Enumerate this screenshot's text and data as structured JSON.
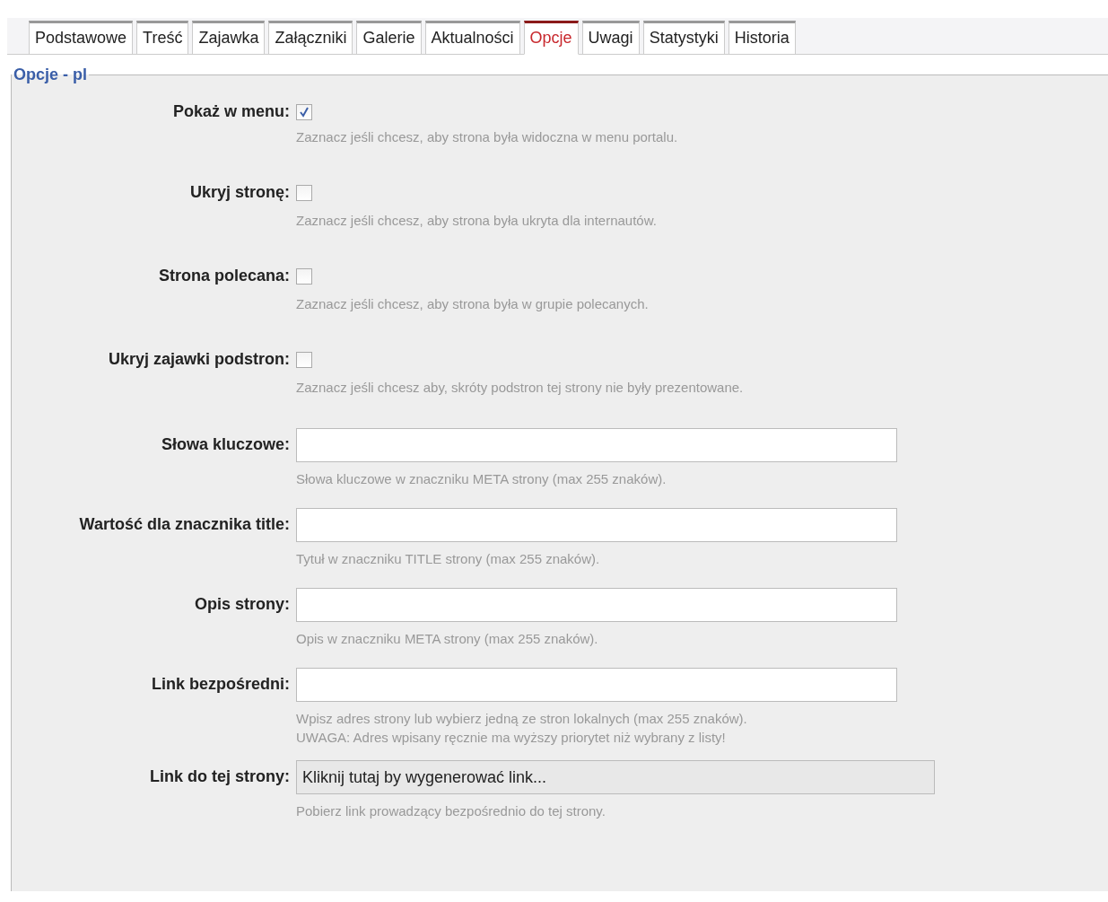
{
  "tabs": [
    {
      "label": "Podstawowe",
      "selected": false
    },
    {
      "label": "Treść",
      "selected": false
    },
    {
      "label": "Zajawka",
      "selected": false
    },
    {
      "label": "Załączniki",
      "selected": false
    },
    {
      "label": "Galerie",
      "selected": false
    },
    {
      "label": "Aktualności",
      "selected": false
    },
    {
      "label": "Opcje",
      "selected": true
    },
    {
      "label": "Uwagi",
      "selected": false
    },
    {
      "label": "Statystyki",
      "selected": false
    },
    {
      "label": "Historia",
      "selected": false
    }
  ],
  "section": {
    "legend": "Opcje - pl"
  },
  "fields": [
    {
      "kind": "checkbox",
      "label": "Pokaż w menu:",
      "checked": true,
      "hint": [
        "Zaznacz jeśli chcesz, aby strona była widoczna w menu portalu."
      ]
    },
    {
      "kind": "checkbox",
      "label": "Ukryj stronę:",
      "checked": false,
      "hint": [
        "Zaznacz jeśli chcesz, aby strona była ukryta dla internautów."
      ]
    },
    {
      "kind": "checkbox",
      "label": "Strona polecana:",
      "checked": false,
      "hint": [
        "Zaznacz jeśli chcesz, aby strona była w grupie polecanych."
      ]
    },
    {
      "kind": "checkbox",
      "label": "Ukryj zajawki podstron:",
      "checked": false,
      "hint": [
        "Zaznacz jeśli chcesz aby, skróty podstron tej strony nie były prezentowane."
      ]
    },
    {
      "kind": "text",
      "label": "Słowa kluczowe:",
      "hint": [
        "Słowa kluczowe w znaczniku META strony (max 255 znaków)."
      ]
    },
    {
      "kind": "text",
      "label": "Wartość dla znacznika title:",
      "hint": [
        "Tytuł w znaczniku TITLE strony (max 255 znaków)."
      ]
    },
    {
      "kind": "text",
      "label": "Opis strony:",
      "hint": [
        "Opis w znaczniku META strony (max 255 znaków)."
      ]
    },
    {
      "kind": "text",
      "label": "Link bezpośredni:",
      "hint": [
        "Wpisz adres strony lub wybierz jedną ze stron lokalnych (max 255 znaków).",
        "UWAGA: Adres wpisany ręcznie ma wyższy priorytet niż wybrany z listy!"
      ]
    },
    {
      "kind": "action",
      "label": "Link do tej strony:",
      "value": "Kliknij tutaj by wygenerować link...",
      "hint": [
        "Pobierz link prowadzący bezpośrednio do tej strony."
      ]
    }
  ]
}
